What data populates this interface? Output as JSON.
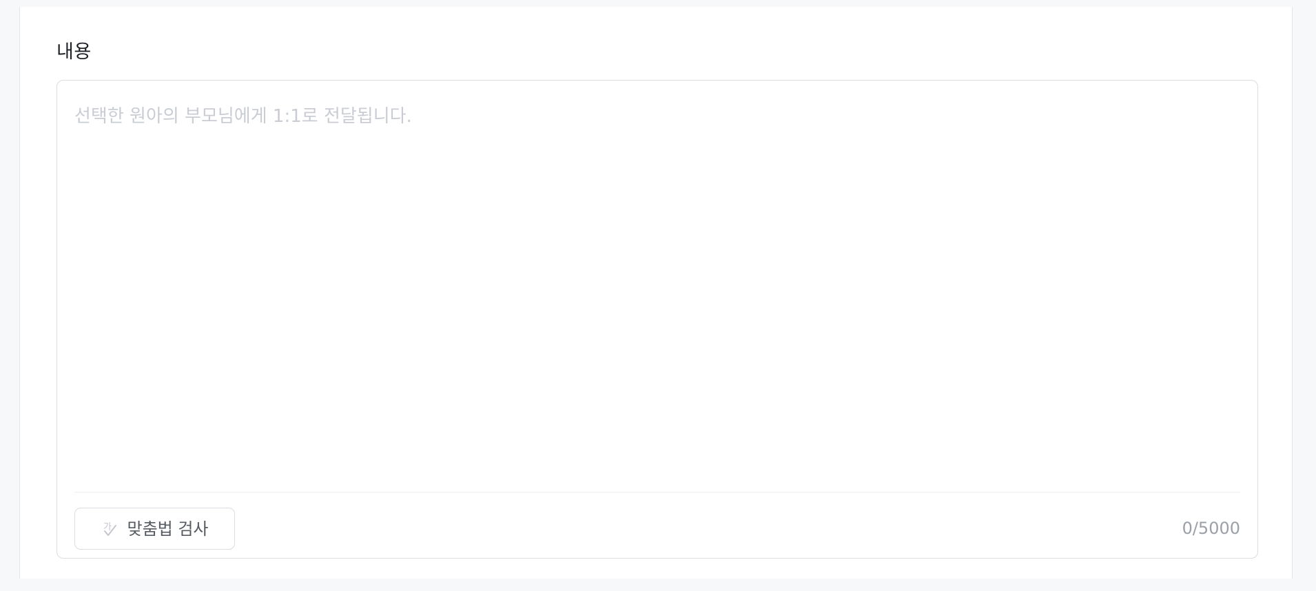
{
  "section": {
    "label": "내용"
  },
  "content": {
    "value": "",
    "placeholder": "선택한 원아의 부모님에게 1:1로 전달됩니다."
  },
  "spellcheck": {
    "label": "맞춤법 검사",
    "icon": "spellcheck-icon"
  },
  "counter": {
    "text": "0/5000"
  }
}
